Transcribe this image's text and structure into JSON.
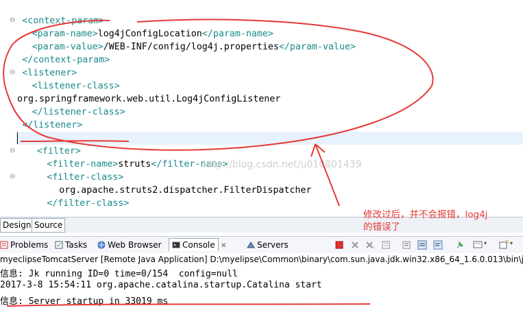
{
  "editor": {
    "lines": [
      {
        "indent": 2,
        "parts": [
          [
            "br",
            "<"
          ],
          [
            "tag",
            "context-param"
          ],
          [
            "br",
            ">"
          ]
        ]
      },
      {
        "indent": 6,
        "parts": [
          [
            "br",
            "<"
          ],
          [
            "tag",
            "param-name"
          ],
          [
            "br",
            ">"
          ],
          [
            "txt",
            "log4jConfigLocation"
          ],
          [
            "br",
            "</"
          ],
          [
            "tag",
            "param-name"
          ],
          [
            "br",
            ">"
          ]
        ]
      },
      {
        "indent": 6,
        "parts": [
          [
            "br",
            "<"
          ],
          [
            "tag",
            "param-value"
          ],
          [
            "br",
            ">"
          ],
          [
            "txt",
            "/WEB-INF/config/log4j.properties"
          ],
          [
            "br",
            "</"
          ],
          [
            "tag",
            "param-value"
          ],
          [
            "br",
            ">"
          ]
        ]
      },
      {
        "indent": 2,
        "parts": [
          [
            "br",
            "</"
          ],
          [
            "tag",
            "context-param"
          ],
          [
            "br",
            ">"
          ]
        ]
      },
      {
        "indent": 2,
        "parts": [
          [
            "br",
            "<"
          ],
          [
            "tag",
            "listener"
          ],
          [
            "br",
            ">"
          ]
        ]
      },
      {
        "indent": 6,
        "parts": [
          [
            "br",
            "<"
          ],
          [
            "tag",
            "listener-class"
          ],
          [
            "br",
            ">"
          ]
        ]
      },
      {
        "indent": 0,
        "parts": [
          [
            "txt",
            "org.springframework.web.util.Log4jConfigListener"
          ]
        ]
      },
      {
        "indent": 6,
        "parts": [
          [
            "br",
            "</"
          ],
          [
            "tag",
            "listener-class"
          ],
          [
            "br",
            ">"
          ]
        ]
      },
      {
        "indent": 2,
        "parts": [
          [
            "br",
            "</"
          ],
          [
            "tag",
            "listener"
          ],
          [
            "br",
            ">"
          ]
        ]
      },
      {
        "indent": 2,
        "parts": []
      },
      {
        "indent": 8,
        "parts": [
          [
            "br",
            "<"
          ],
          [
            "tag",
            "filter"
          ],
          [
            "br",
            ">"
          ]
        ]
      },
      {
        "indent": 12,
        "parts": [
          [
            "br",
            "<"
          ],
          [
            "tag",
            "filter-name"
          ],
          [
            "br",
            ">"
          ],
          [
            "txt",
            "struts"
          ],
          [
            "br",
            "</"
          ],
          [
            "tag",
            "filter-name"
          ],
          [
            "br",
            ">"
          ]
        ]
      },
      {
        "indent": 12,
        "parts": [
          [
            "br",
            "<"
          ],
          [
            "tag",
            "filter-class"
          ],
          [
            "br",
            ">"
          ]
        ]
      },
      {
        "indent": 17,
        "parts": [
          [
            "txt",
            "org.apache.struts2.dispatcher.FilterDispatcher"
          ]
        ]
      },
      {
        "indent": 12,
        "parts": [
          [
            "br",
            "</"
          ],
          [
            "tag",
            "filter-class"
          ],
          [
            "br",
            ">"
          ]
        ]
      }
    ],
    "watermark": "http://blog.csdn.net/u010801439"
  },
  "editor_tabs": [
    {
      "label": "Design"
    },
    {
      "label": "Source"
    }
  ],
  "views": {
    "problems": "Problems",
    "tasks": "Tasks",
    "web_browser": "Web Browser",
    "console": "Console",
    "servers": "Servers"
  },
  "console": {
    "header": "myeclipseTomcatServer [Remote Java Application] D:\\myelipse\\Common\\binary\\com.sun.java.jdk.win32.x86_64_1.6.0.013\\bin\\javaw.exe",
    "lines": [
      "信息: Jk running ID=0 time=0/154  config=null",
      "2017-3-8 15:54:11 org.apache.catalina.startup.Catalina start",
      "信息: Server startup in 33019 ms"
    ]
  },
  "annotation": {
    "line1": "修改过后，并不会报错，log4j",
    "line2": "的错误了"
  },
  "colors": {
    "tag": "#1a8a8a",
    "annotation": "#e53935",
    "current_line": "#e8f2fe"
  }
}
